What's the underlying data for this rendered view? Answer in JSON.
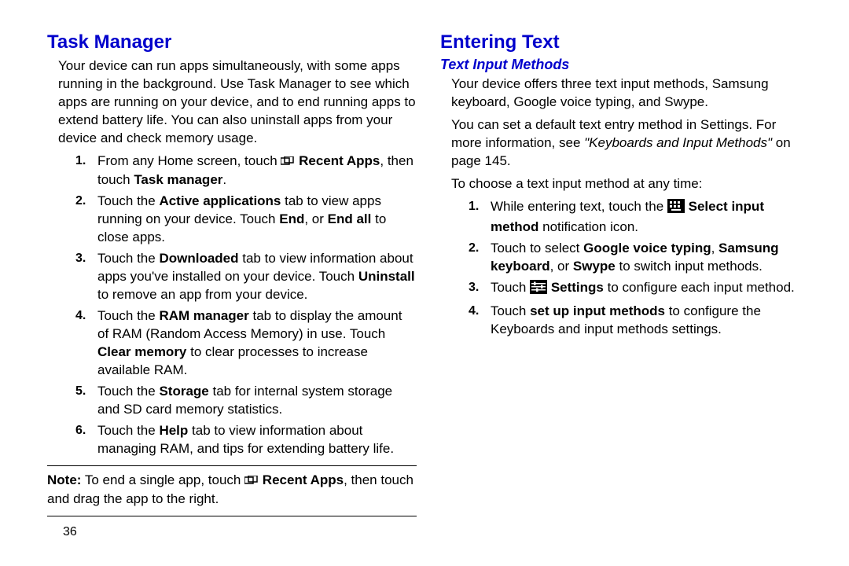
{
  "left": {
    "heading": "Task Manager",
    "intro": "Your device can run apps simultaneously, with some apps running in the background. Use Task Manager to see which apps are running on your device, and to end running apps to extend battery life. You can also uninstall apps from your device and check memory usage.",
    "steps": {
      "1_a": "From any Home screen, touch ",
      "1_b": " Recent Apps",
      "1_c": ", then touch ",
      "1_d": "Task manager",
      "1_e": ".",
      "2_a": "Touch the ",
      "2_b": "Active applications",
      "2_c": " tab to view apps running on your device. Touch ",
      "2_d": "End",
      "2_e": ", or ",
      "2_f": "End all",
      "2_g": " to close apps.",
      "3_a": "Touch the ",
      "3_b": "Downloaded",
      "3_c": " tab to view information about apps you've installed on your device. Touch ",
      "3_d": "Uninstall",
      "3_e": " to remove an app from your device.",
      "4_a": "Touch the ",
      "4_b": "RAM manager",
      "4_c": " tab to display the amount of RAM (Random Access Memory) in use. Touch ",
      "4_d": "Clear memory",
      "4_e": " to clear processes to increase available RAM.",
      "5_a": "Touch the ",
      "5_b": "Storage",
      "5_c": " tab for internal system storage and SD card memory statistics.",
      "6_a": "Touch the ",
      "6_b": "Help",
      "6_c": " tab to view information about managing RAM, and tips for extending battery life."
    },
    "note": {
      "label": "Note:",
      "a": " To end a single app, touch ",
      "b": " Recent Apps",
      "c": ", then touch and drag the app to the right."
    }
  },
  "right": {
    "heading": "Entering Text",
    "sub": "Text Input Methods",
    "p1": "Your device offers three text input methods, Samsung keyboard, Google voice typing, and Swype.",
    "p2_a": "You can set a default text entry method in Settings. For more information, see ",
    "p2_b": "\"Keyboards and Input Methods\"",
    "p2_c": " on page 145.",
    "p3": "To choose a text input method at any time:",
    "steps": {
      "1_a": "While entering text, touch the ",
      "1_b": " Select input method",
      "1_c": " notification icon.",
      "2_a": "Touch to select ",
      "2_b": "Google voice typing",
      "2_c": ", ",
      "2_d": "Samsung keyboard",
      "2_e": ", or ",
      "2_f": "Swype",
      "2_g": " to switch input methods.",
      "3_a": "Touch ",
      "3_b": " Settings",
      "3_c": " to configure each input method.",
      "4_a": "Touch ",
      "4_b": "set up input methods",
      "4_c": " to configure the Keyboards and input methods settings."
    }
  },
  "page_number": "36",
  "nums": {
    "n1": "1.",
    "n2": "2.",
    "n3": "3.",
    "n4": "4.",
    "n5": "5.",
    "n6": "6."
  }
}
